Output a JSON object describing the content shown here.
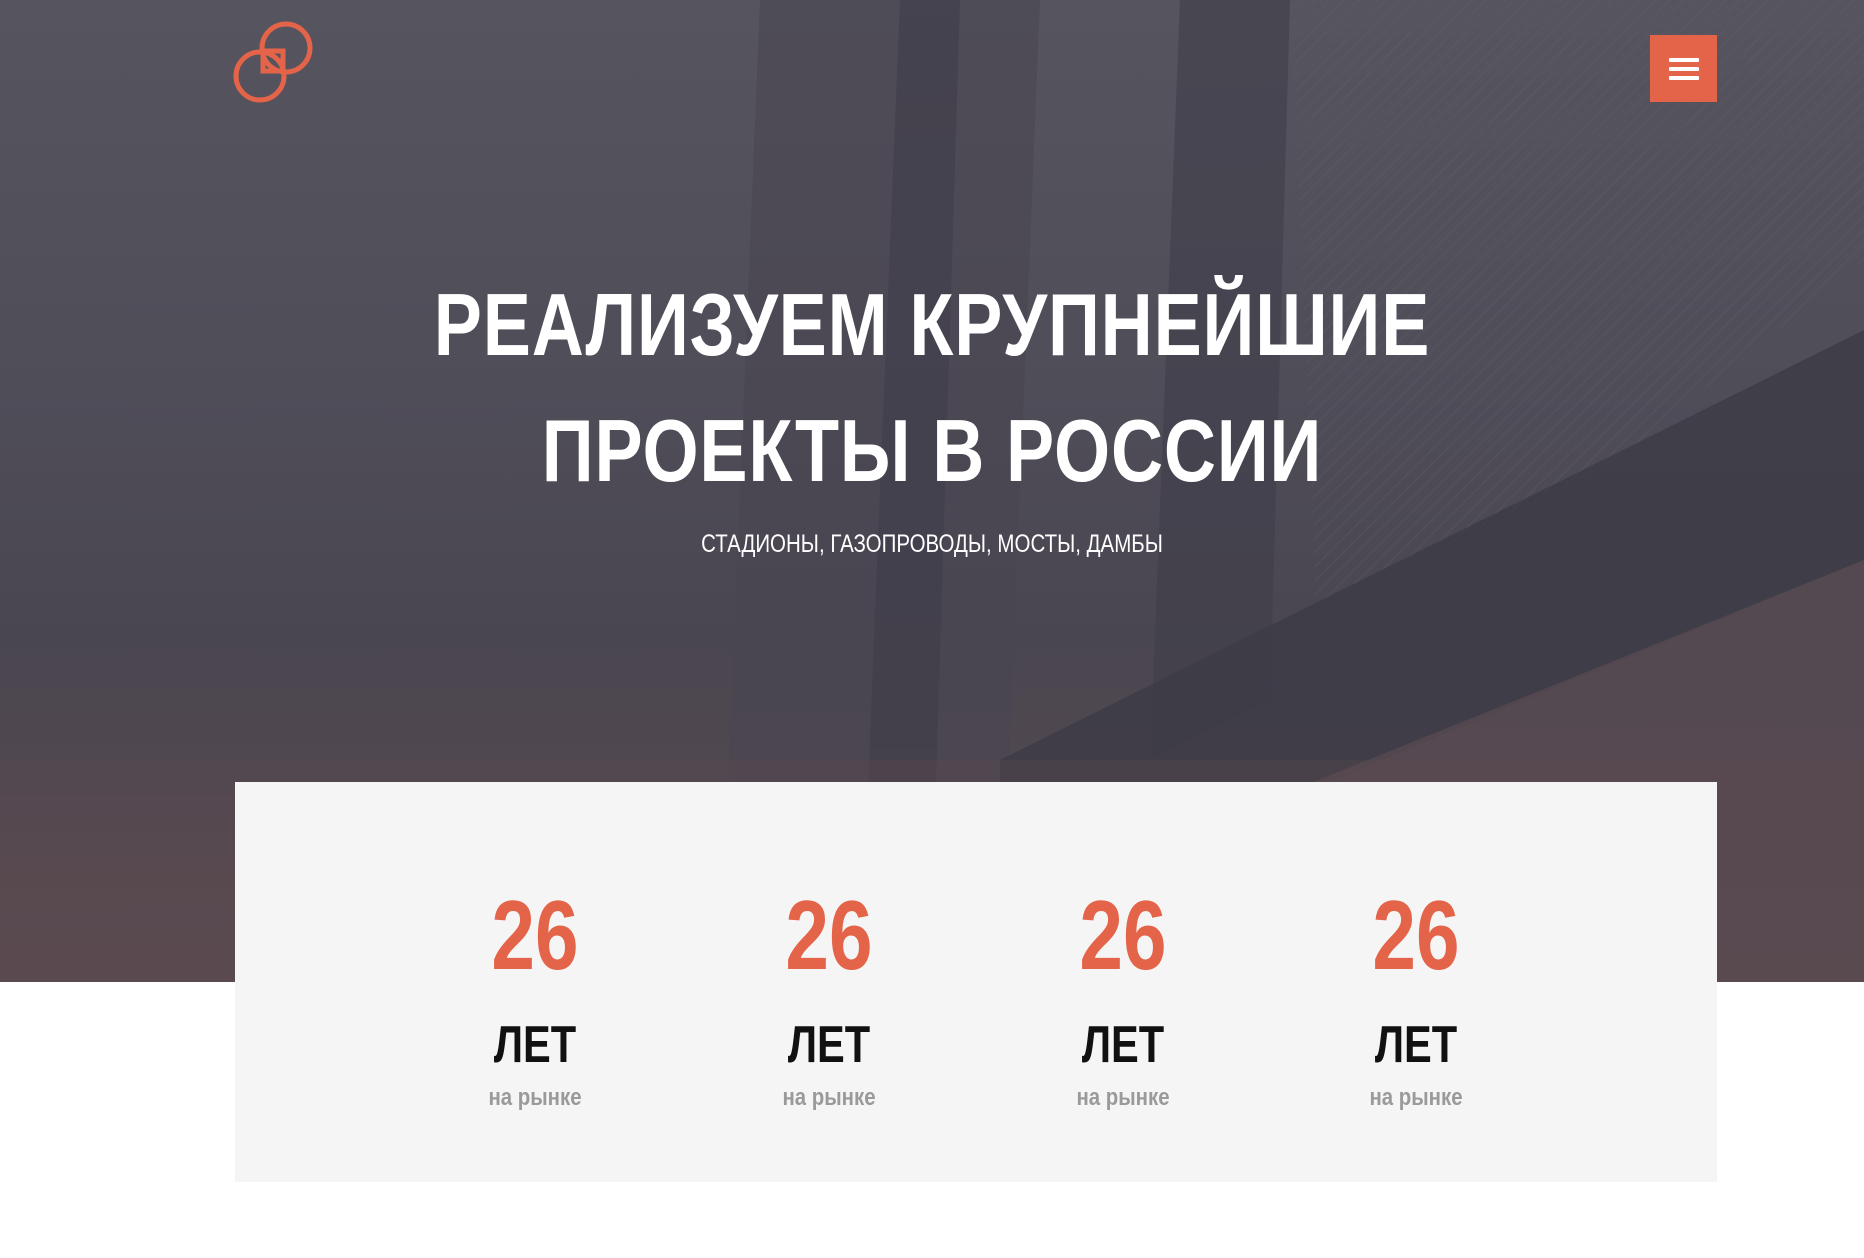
{
  "brand": {
    "logo_icon": "interlocked-rings-logo-icon",
    "accent_color": "#e4644a"
  },
  "header": {
    "menu_icon": "hamburger-menu-icon"
  },
  "hero": {
    "title_line1": "РЕАЛИЗУЕМ КРУПНЕЙШИЕ",
    "title_line2": "ПРОЕКТЫ В РОССИИ",
    "subtitle": "СТАДИОНЫ, ГАЗОПРОВОДЫ, МОСТЫ, ДАМБЫ"
  },
  "stats": [
    {
      "number": "26",
      "unit": "ЛЕТ",
      "caption": "на рынке"
    },
    {
      "number": "26",
      "unit": "ЛЕТ",
      "caption": "на рынке"
    },
    {
      "number": "26",
      "unit": "ЛЕТ",
      "caption": "на рынке"
    },
    {
      "number": "26",
      "unit": "ЛЕТ",
      "caption": "на рынке"
    }
  ]
}
